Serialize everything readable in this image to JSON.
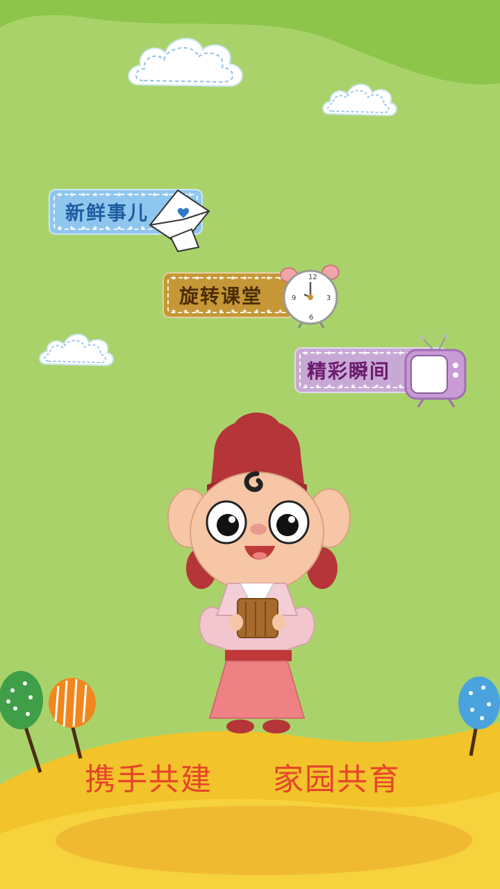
{
  "menu": {
    "news_label": "新鲜事儿",
    "class_label": "旋转课堂",
    "moments_label": "精彩瞬间"
  },
  "slogan": {
    "left": "携手共建",
    "right": "家园共育"
  },
  "colors": {
    "background": "#a9d36a",
    "hill": "#f2c32a",
    "slogan": "#e5442a"
  },
  "icons": {
    "news": "envelope-icon",
    "class": "alarm-clock-icon",
    "moments": "tv-icon"
  }
}
